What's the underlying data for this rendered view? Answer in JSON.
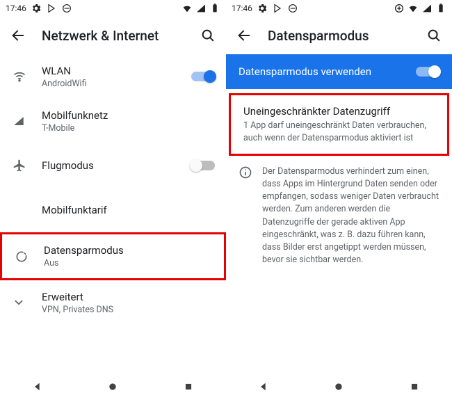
{
  "left": {
    "status": {
      "time": "17:46"
    },
    "appbar": {
      "title": "Netzwerk & Internet"
    },
    "items": {
      "wifi": {
        "label": "WLAN",
        "sub": "AndroidWifi"
      },
      "cellular": {
        "label": "Mobilfunknetz",
        "sub": "T-Mobile"
      },
      "airplane": {
        "label": "Flugmodus"
      },
      "plan": {
        "label": "Mobilfunktarif"
      },
      "datasaver": {
        "label": "Datensparmodus",
        "sub": "Aus"
      },
      "advanced": {
        "label": "Erweitert",
        "sub": "VPN, Privates DNS"
      }
    }
  },
  "right": {
    "status": {
      "time": "17:46"
    },
    "appbar": {
      "title": "Datensparmodus"
    },
    "banner": {
      "label": "Datensparmodus verwenden"
    },
    "unrestricted": {
      "label": "Uneingeschränkter Datenzugriff",
      "sub": "1 App darf uneingeschränkt Daten verbrauchen, auch wenn der Datensparmodus aktiviert ist"
    },
    "info": {
      "body": "Der Datensparmodus verhindert zum einen, dass Apps im Hintergrund Daten senden oder empfangen, sodass weniger Daten verbraucht werden. Zum anderen werden die Datenzugriffe der gerade aktiven App eingeschränkt, was z. B. dazu führen kann, dass Bilder erst angetippt werden müssen, bevor sie sichtbar werden."
    }
  }
}
